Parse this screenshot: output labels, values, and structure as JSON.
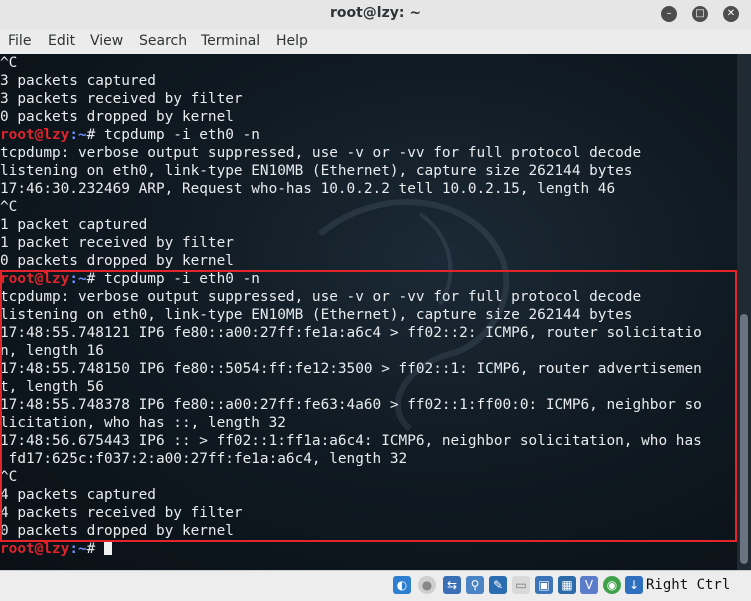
{
  "window": {
    "title": "root@lzy: ~",
    "buttons": {
      "minimize": "–",
      "maximize": "□",
      "close": "✕"
    }
  },
  "menu": [
    "File",
    "Edit",
    "View",
    "Search",
    "Terminal",
    "Help"
  ],
  "terminal": {
    "lines": [
      {
        "text": "^C"
      },
      {
        "text": "3 packets captured"
      },
      {
        "text": "3 packets received by filter"
      },
      {
        "text": "0 packets dropped by kernel"
      },
      {
        "prompt": true,
        "user": "root@lzy",
        "path": ":~",
        "cmd": "# tcpdump -i eth0 -n"
      },
      {
        "text": "tcpdump: verbose output suppressed, use -v or -vv for full protocol decode"
      },
      {
        "text": "listening on eth0, link-type EN10MB (Ethernet), capture size 262144 bytes"
      },
      {
        "text": "17:46:30.232469 ARP, Request who-has 10.0.2.2 tell 10.0.2.15, length 46"
      },
      {
        "text": "^C"
      },
      {
        "text": "1 packet captured"
      },
      {
        "text": "1 packet received by filter"
      },
      {
        "text": "0 packets dropped by kernel"
      },
      {
        "prompt": true,
        "user": "root@lzy",
        "path": ":~",
        "cmd": "# tcpdump -i eth0 -n"
      },
      {
        "text": "tcpdump: verbose output suppressed, use -v or -vv for full protocol decode"
      },
      {
        "text": "listening on eth0, link-type EN10MB (Ethernet), capture size 262144 bytes"
      },
      {
        "text": "17:48:55.748121 IP6 fe80::a00:27ff:fe1a:a6c4 > ff02::2: ICMP6, router solicitatio"
      },
      {
        "text": "n, length 16"
      },
      {
        "text": "17:48:55.748150 IP6 fe80::5054:ff:fe12:3500 > ff02::1: ICMP6, router advertisemen"
      },
      {
        "text": "t, length 56"
      },
      {
        "text": "17:48:55.748378 IP6 fe80::a00:27ff:fe63:4a60 > ff02::1:ff00:0: ICMP6, neighbor so"
      },
      {
        "text": "licitation, who has ::, length 32"
      },
      {
        "text": "17:48:56.675443 IP6 :: > ff02::1:ff1a:a6c4: ICMP6, neighbor solicitation, who has"
      },
      {
        "text": " fd17:625c:f037:2:a00:27ff:fe1a:a6c4, length 32"
      },
      {
        "text": "^C"
      },
      {
        "text": "4 packets captured"
      },
      {
        "text": "4 packets received by filter"
      },
      {
        "text": "0 packets dropped by kernel"
      },
      {
        "prompt": true,
        "user": "root@lzy",
        "path": ":~",
        "cmd": "# ",
        "cursor": true
      }
    ]
  },
  "statusbar": {
    "host_key": "Right Ctrl",
    "icons": [
      "cd-icon",
      "disk-icon",
      "network-icon",
      "usb-icon",
      "shared-folder-icon",
      "display-icon",
      "screen-icon",
      "monitor-icon",
      "video-capture-icon",
      "cpu-icon",
      "mouse-icon",
      "keyboard-icon"
    ]
  },
  "colors": {
    "accent_red": "#e3242b",
    "prompt_user": "#e0242b",
    "prompt_path": "#6f8fff"
  }
}
